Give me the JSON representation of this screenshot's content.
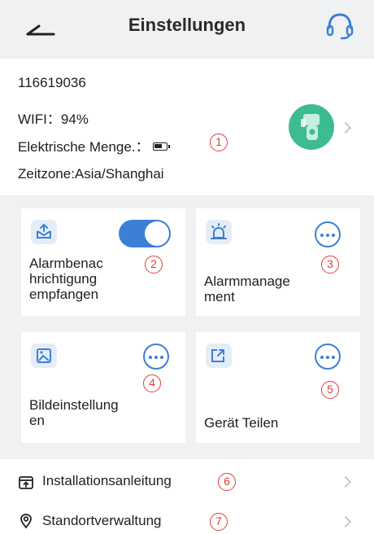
{
  "header": {
    "title": "Einstellungen",
    "back_icon": "back-arrow-icon",
    "support_icon": "headset-icon"
  },
  "device": {
    "id": "116619036",
    "wifi": "WIFI：94%",
    "power_label": "Elektrische Menge.：",
    "timezone": "Zeitzone:Asia/Shanghai",
    "avatar_color": "#3dbb92"
  },
  "annotations": [
    "1",
    "2",
    "3",
    "4",
    "5",
    "6",
    "7"
  ],
  "tiles": [
    {
      "label": "Alarmbenac\nhrichtigung\nempfangen",
      "icon": "alarm-notification-icon",
      "toggle_on": true
    },
    {
      "label": "Alarmmanage\nment",
      "icon": "alarm-icon"
    },
    {
      "label": "Bildeinstellung\nen",
      "icon": "image-icon"
    },
    {
      "label": "Gerät Teilen",
      "icon": "share-icon"
    }
  ],
  "rows": [
    {
      "label": "Installationsanleitung",
      "icon": "install-guide-icon"
    },
    {
      "label": "Standortverwaltung",
      "icon": "location-icon"
    }
  ],
  "colors": {
    "accent": "#3b7fd6",
    "annotation": "#e23b3b",
    "background": "#f0f1f3"
  }
}
